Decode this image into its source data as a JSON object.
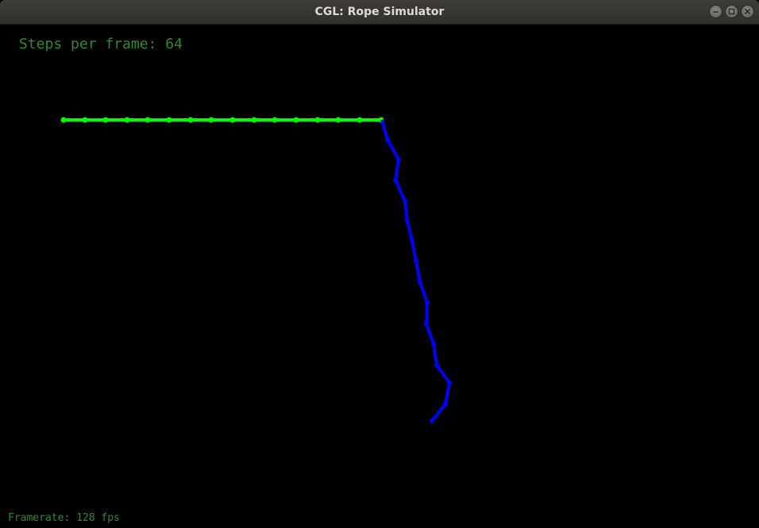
{
  "window": {
    "title": "CGL: Rope Simulator"
  },
  "hud": {
    "steps_label": "Steps per frame: 64",
    "framerate_label": "Framerate: 128 fps"
  },
  "colors": {
    "background": "#000000",
    "text": "#2e8b2e",
    "rope_green": "#00ff00",
    "rope_blue": "#0000ff"
  },
  "icons": {
    "minimize": "minimize-icon",
    "maximize": "maximize-icon",
    "close": "close-icon"
  }
}
